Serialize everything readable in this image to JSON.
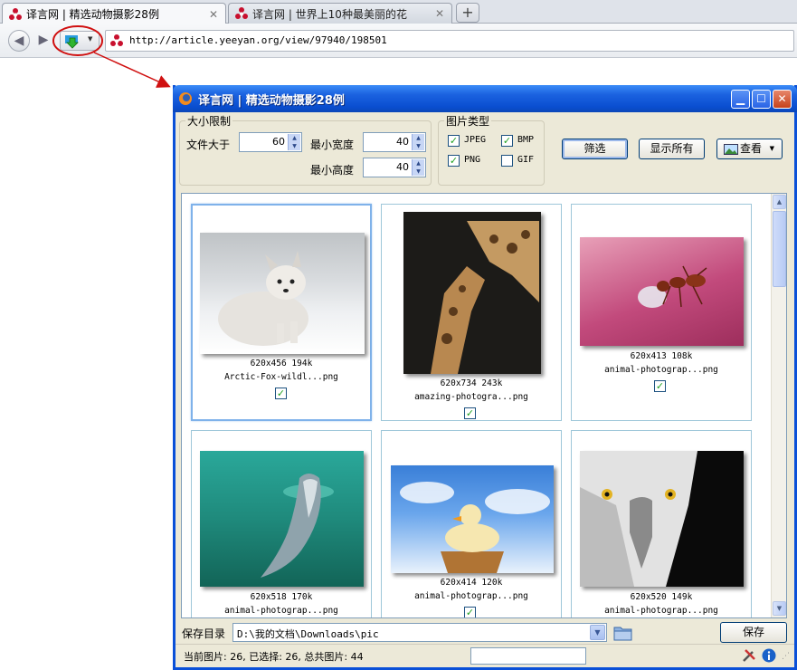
{
  "browser": {
    "tabs": [
      {
        "label": "译言网 | 精选动物摄影28例",
        "active": true
      },
      {
        "label": "译言网 | 世界上10种最美丽的花",
        "active": false
      }
    ],
    "new_tab": "+",
    "url": "http://article.yeeyan.org/view/97940/198501"
  },
  "dialog": {
    "title": "译言网 | 精选动物摄影28例",
    "size_group": {
      "legend": "大小限制",
      "file_size_label": "文件大于",
      "file_size_value": "60",
      "min_width_label": "最小宽度",
      "min_width_value": "40",
      "min_height_label": "最小高度",
      "min_height_value": "40"
    },
    "type_group": {
      "legend": "图片类型",
      "types": [
        {
          "label": "JPEG",
          "checked": true
        },
        {
          "label": "BMP",
          "checked": true
        },
        {
          "label": "PNG",
          "checked": true
        },
        {
          "label": "GIF",
          "checked": false
        }
      ]
    },
    "buttons": {
      "filter": "筛选",
      "show_all": "显示所有",
      "view": "查看"
    },
    "images": [
      {
        "size": "620x456 194k",
        "name": "Arctic-Fox-wildl...png",
        "checked": true,
        "selected": true
      },
      {
        "size": "620x734 243k",
        "name": "amazing-photogra...png",
        "checked": true,
        "selected": false
      },
      {
        "size": "620x413 108k",
        "name": "animal-photograp...png",
        "checked": true,
        "selected": false
      },
      {
        "size": "620x518 170k",
        "name": "animal-photograp...png",
        "checked": true,
        "selected": false
      },
      {
        "size": "620x414 120k",
        "name": "animal-photograp...png",
        "checked": true,
        "selected": false
      },
      {
        "size": "620x520 149k",
        "name": "animal-photograp...png",
        "checked": true,
        "selected": false
      }
    ],
    "save_dir_label": "保存目录",
    "save_dir_value": "D:\\我的文档\\Downloads\\pic",
    "save_button": "保存",
    "status": "当前图片: 26, 已选择: 26, 总共图片: 44"
  },
  "colors": {
    "annotation": "#d01010",
    "title_bar": "#0a4ed0",
    "check": "#21a121"
  }
}
